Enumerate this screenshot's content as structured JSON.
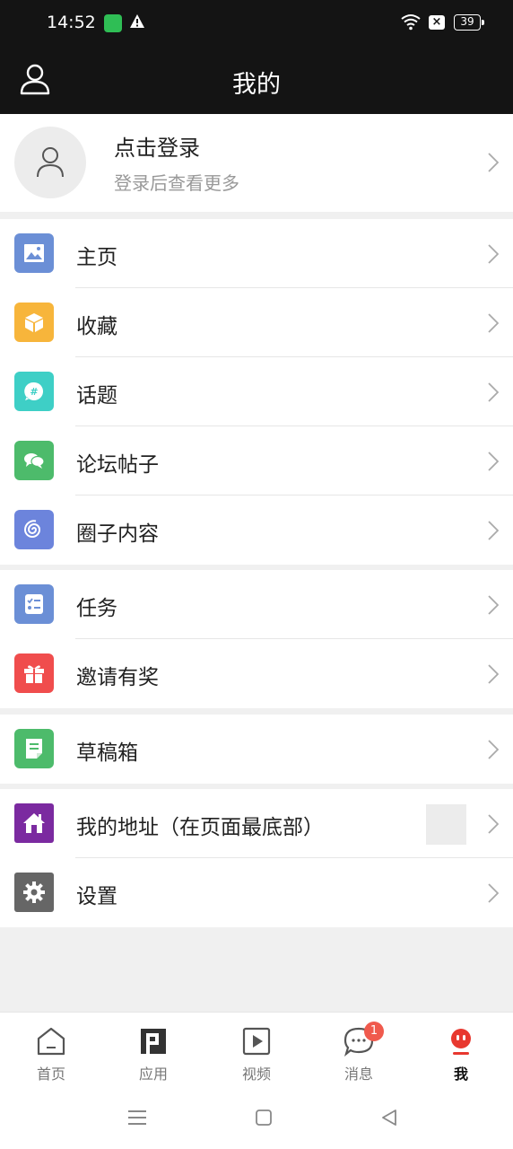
{
  "status_bar": {
    "time": "14:52",
    "battery": "39",
    "icons": [
      "app-notification-icon",
      "warning-icon",
      "wifi-icon",
      "close-box-icon",
      "battery-icon"
    ]
  },
  "header": {
    "title": "我的",
    "left_icon": "user-icon"
  },
  "login": {
    "title": "点击登录",
    "subtitle": "登录后查看更多"
  },
  "menu_groups": [
    {
      "items": [
        {
          "label": "主页",
          "icon": "image-icon",
          "color": "#6b8fd6"
        },
        {
          "label": "收藏",
          "icon": "box-icon",
          "color": "#f7b53b"
        },
        {
          "label": "话题",
          "icon": "hashtag-bubble-icon",
          "color": "#3ecfc6"
        },
        {
          "label": "论坛帖子",
          "icon": "chat-bubbles-icon",
          "color": "#4dbb6b"
        },
        {
          "label": "圈子内容",
          "icon": "spiral-icon",
          "color": "#6c84dc"
        }
      ]
    },
    {
      "items": [
        {
          "label": "任务",
          "icon": "checklist-icon",
          "color": "#6b8fd6"
        },
        {
          "label": "邀请有奖",
          "icon": "gift-icon",
          "color": "#f04d4d"
        }
      ]
    },
    {
      "items": [
        {
          "label": "草稿箱",
          "icon": "draft-icon",
          "color": "#4dbb6b"
        }
      ]
    },
    {
      "items": [
        {
          "label": "我的地址（在页面最底部）",
          "icon": "house-icon",
          "color": "#7b2aa0"
        },
        {
          "label": "设置",
          "icon": "gear-icon",
          "color": "#666666"
        }
      ]
    }
  ],
  "bottom_nav": [
    {
      "label": "首页",
      "icon": "home-icon"
    },
    {
      "label": "应用",
      "icon": "apps-icon"
    },
    {
      "label": "视频",
      "icon": "video-icon"
    },
    {
      "label": "消息",
      "icon": "message-icon",
      "badge": "1"
    },
    {
      "label": "我",
      "icon": "me-icon",
      "active": true
    }
  ],
  "colors": {
    "header_bg": "#141414",
    "accent_red": "#e8382f",
    "badge": "#f05a4d"
  }
}
